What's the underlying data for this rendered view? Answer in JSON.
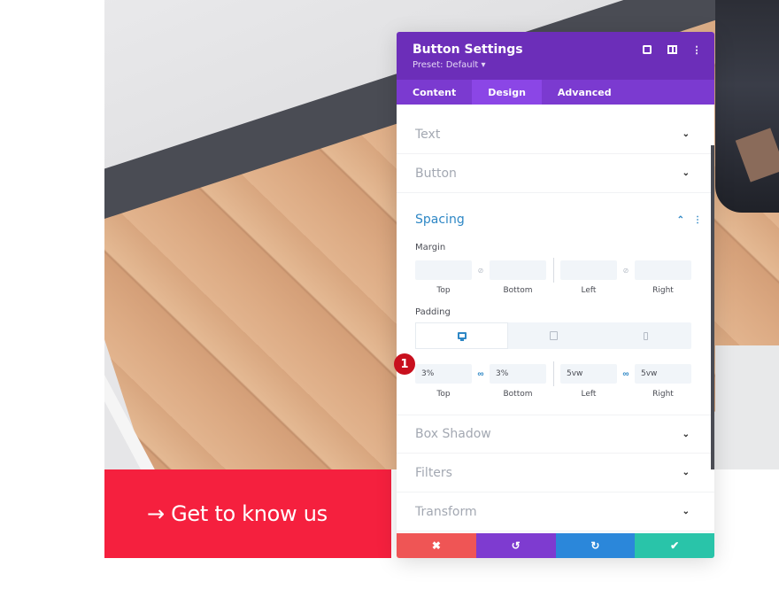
{
  "panel": {
    "title": "Button Settings",
    "preset": "Preset: Default ▾",
    "header_icons": [
      "focus-icon",
      "split-view-icon",
      "more-options-icon"
    ],
    "tabs": [
      {
        "label": "Content",
        "active": false
      },
      {
        "label": "Design",
        "active": true
      },
      {
        "label": "Advanced",
        "active": false
      }
    ],
    "sections_top": [
      {
        "label": "Text"
      },
      {
        "label": "Button"
      }
    ],
    "spacing": {
      "label": "Spacing",
      "margin": {
        "label": "Margin",
        "top": "",
        "bottom": "",
        "left": "",
        "right": "",
        "linked_vertical": false,
        "linked_horizontal": false
      },
      "padding": {
        "label": "Padding",
        "devices": [
          "desktop",
          "tablet",
          "phone"
        ],
        "active_device": "desktop",
        "top": "3%",
        "bottom": "3%",
        "left": "5vw",
        "right": "5vw",
        "linked_vertical": true,
        "linked_horizontal": true
      },
      "sublabels": {
        "top": "Top",
        "bottom": "Bottom",
        "left": "Left",
        "right": "Right"
      }
    },
    "sections_bottom": [
      {
        "label": "Box Shadow"
      },
      {
        "label": "Filters"
      },
      {
        "label": "Transform"
      }
    ],
    "footer": {
      "cancel": "✖",
      "undo": "↺",
      "redo": "↻",
      "save": "✔"
    }
  },
  "annotation_badge": "1",
  "cta": {
    "label": "→ Get to know us",
    "color": "#f5203e"
  },
  "colors": {
    "header": "#6c2eb9",
    "tabs": "#7b3ad0",
    "active_tab": "#8b46e6",
    "accent": "#2e87c5",
    "cancel": "#ef5555",
    "undo": "#7e3bd0",
    "redo": "#2b87da",
    "save": "#29c4a9"
  }
}
